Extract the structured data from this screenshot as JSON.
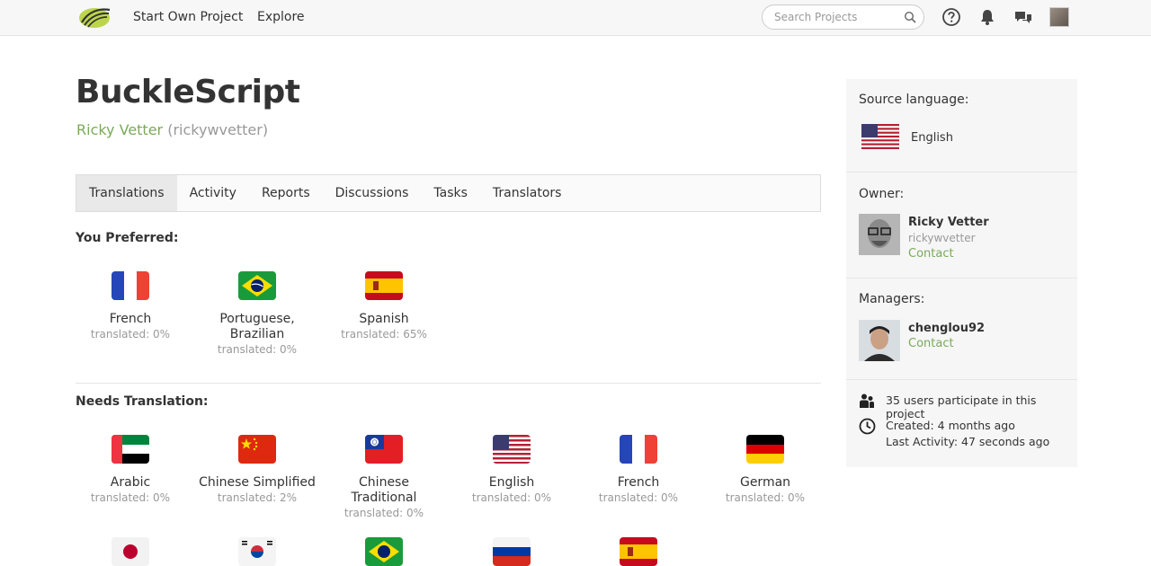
{
  "nav": {
    "start_project": "Start Own Project",
    "explore": "Explore",
    "search_placeholder": "Search Projects"
  },
  "project": {
    "title": "BuckleScript",
    "owner_name": "Ricky Vetter",
    "owner_username": "(rickywvetter)"
  },
  "tabs": [
    "Translations",
    "Activity",
    "Reports",
    "Discussions",
    "Tasks",
    "Translators"
  ],
  "preferred": {
    "heading": "You Preferred:",
    "languages": [
      {
        "name": "French",
        "status": "translated: 0%",
        "flag": "fr-flag"
      },
      {
        "name": "Portuguese, Brazilian",
        "status": "translated: 0%",
        "flag": "br-flag"
      },
      {
        "name": "Spanish",
        "status": "translated: 65%",
        "flag": "es-flag"
      }
    ]
  },
  "needs": {
    "heading": "Needs Translation:",
    "languages": [
      {
        "name": "Arabic",
        "status": "translated: 0%",
        "flag": "ae-flag"
      },
      {
        "name": "Chinese Simplified",
        "status": "translated: 2%",
        "flag": "cn-flag"
      },
      {
        "name": "Chinese Traditional",
        "status": "translated: 0%",
        "flag": "tw-flag"
      },
      {
        "name": "English",
        "status": "translated: 0%",
        "flag": "us-flag"
      },
      {
        "name": "French",
        "status": "translated: 0%",
        "flag": "fr-flag"
      },
      {
        "name": "German",
        "status": "translated: 0%",
        "flag": "de-flag"
      }
    ],
    "partial_flags": [
      "jp-flag",
      "kr-flag",
      "br-flag",
      "ru-flag",
      "es-flag"
    ]
  },
  "sidebar": {
    "source_label": "Source language:",
    "source_language": "English",
    "owner_label": "Owner:",
    "owner_name": "Ricky Vetter",
    "owner_username": "rickywvetter",
    "contact": "Contact",
    "managers_label": "Managers:",
    "manager_name": "chenglou92",
    "participants": "35 users participate in this project",
    "created": "Created: 4 months ago",
    "last_activity": "Last Activity: 47 seconds ago"
  },
  "colors": {
    "accent_green": "#7aaa5a",
    "muted_gray": "#999999"
  }
}
